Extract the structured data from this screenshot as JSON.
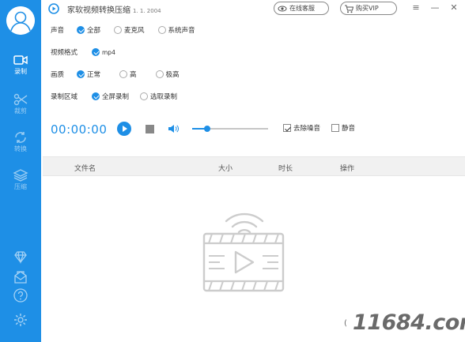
{
  "title": {
    "name": "家软视频转换压缩",
    "version": "1. 1. 2004"
  },
  "titlebar": {
    "service_label": "在线客服",
    "vip_label": "购买VIP",
    "menu_icon": "hamburger-icon",
    "minimize_icon": "minimize-icon",
    "close_icon": "close-icon"
  },
  "sidebar": {
    "avatar_icon": "user-avatar-icon",
    "items": [
      {
        "label": "录制",
        "icon": "video-camera-icon",
        "active": true
      },
      {
        "label": "裁剪",
        "icon": "scissors-icon",
        "active": false
      },
      {
        "label": "转换",
        "icon": "convert-icon",
        "active": false
      },
      {
        "label": "压缩",
        "icon": "layers-icon",
        "active": false
      }
    ],
    "bottom_icons": [
      "diamond-icon",
      "mail-icon",
      "help-icon",
      "settings-icon"
    ]
  },
  "settings": {
    "audio": {
      "label": "声音",
      "options": [
        "全部",
        "麦克风",
        "系统声音"
      ],
      "selected": "全部"
    },
    "format": {
      "label": "视频格式",
      "options": [
        "mp4"
      ],
      "selected": "mp4"
    },
    "quality": {
      "label": "画质",
      "options": [
        "正常",
        "高",
        "极高"
      ],
      "selected": "正常"
    },
    "region": {
      "label": "录制区域",
      "options": [
        "全屏录制",
        "选取录制"
      ],
      "selected": "全屏录制"
    }
  },
  "controls": {
    "timer": "00:00:00",
    "volume": 0.2,
    "denoise_label": "去除噪音",
    "denoise_checked": true,
    "mute_label": "静音",
    "mute_checked": false
  },
  "table": {
    "columns": [
      "文件名",
      "大小",
      "时长",
      "操作"
    ],
    "rows": []
  },
  "empty_state": {
    "icon": "empty-video-icon"
  },
  "footer": {
    "paren": "(",
    "watermark": "11684.com"
  },
  "colors": {
    "accent": "#1e8fe6"
  }
}
